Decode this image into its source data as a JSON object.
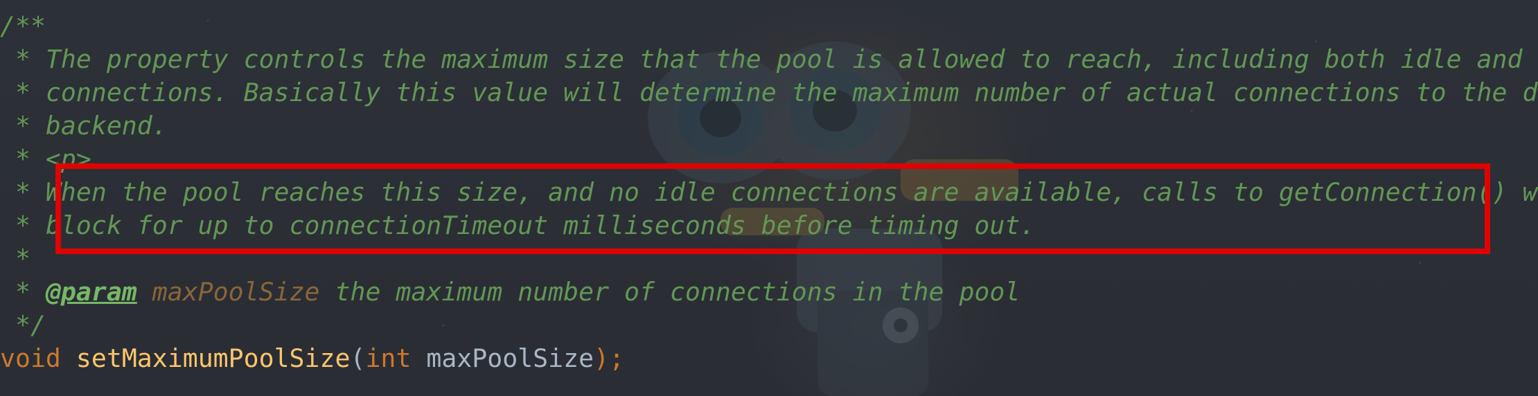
{
  "editor": {
    "lines": [
      {
        "id": "comment-open",
        "text": "/**"
      },
      {
        "id": "desc-1",
        "text": " * The property controls the maximum size that the pool is allowed to reach, including both idle and in-use"
      },
      {
        "id": "desc-2",
        "text": " * connections. Basically this value will determine the maximum number of actual connections to the database"
      },
      {
        "id": "desc-3",
        "text": " * backend."
      },
      {
        "id": "para-tag",
        "text": " * <p>"
      },
      {
        "id": "highlight-1-prefix",
        "text": " * "
      },
      {
        "id": "highlight-1",
        "text": "When the pool reaches this size, and no idle connections are available, calls to getConnection() will"
      },
      {
        "id": "highlight-2-prefix",
        "text": " * "
      },
      {
        "id": "highlight-2",
        "text": "block for up to connectionTimeout milliseconds before timing out."
      },
      {
        "id": "blank",
        "text": " *"
      },
      {
        "id": "param-prefix",
        "text": " * "
      },
      {
        "id": "param-tag",
        "text": "@param"
      },
      {
        "id": "param-name",
        "text": "maxPoolSize"
      },
      {
        "id": "param-desc",
        "text": " the maximum number of connections in the pool"
      },
      {
        "id": "comment-close",
        "text": " */"
      }
    ],
    "signature": {
      "return_type": "void",
      "method_name": "setMaximumPoolSize",
      "open_paren": "(",
      "param_type": "int",
      "param_name": "maxPoolSize",
      "close": ");"
    }
  },
  "colors": {
    "background": "#2b2f36",
    "comment": "#629755",
    "javadoc_tag": "#77b767",
    "param_name": "#8a653b",
    "keyword": "#cc7832",
    "method": "#ffc66d",
    "plain": "#a9b7c6",
    "highlight_border": "#e00000"
  }
}
